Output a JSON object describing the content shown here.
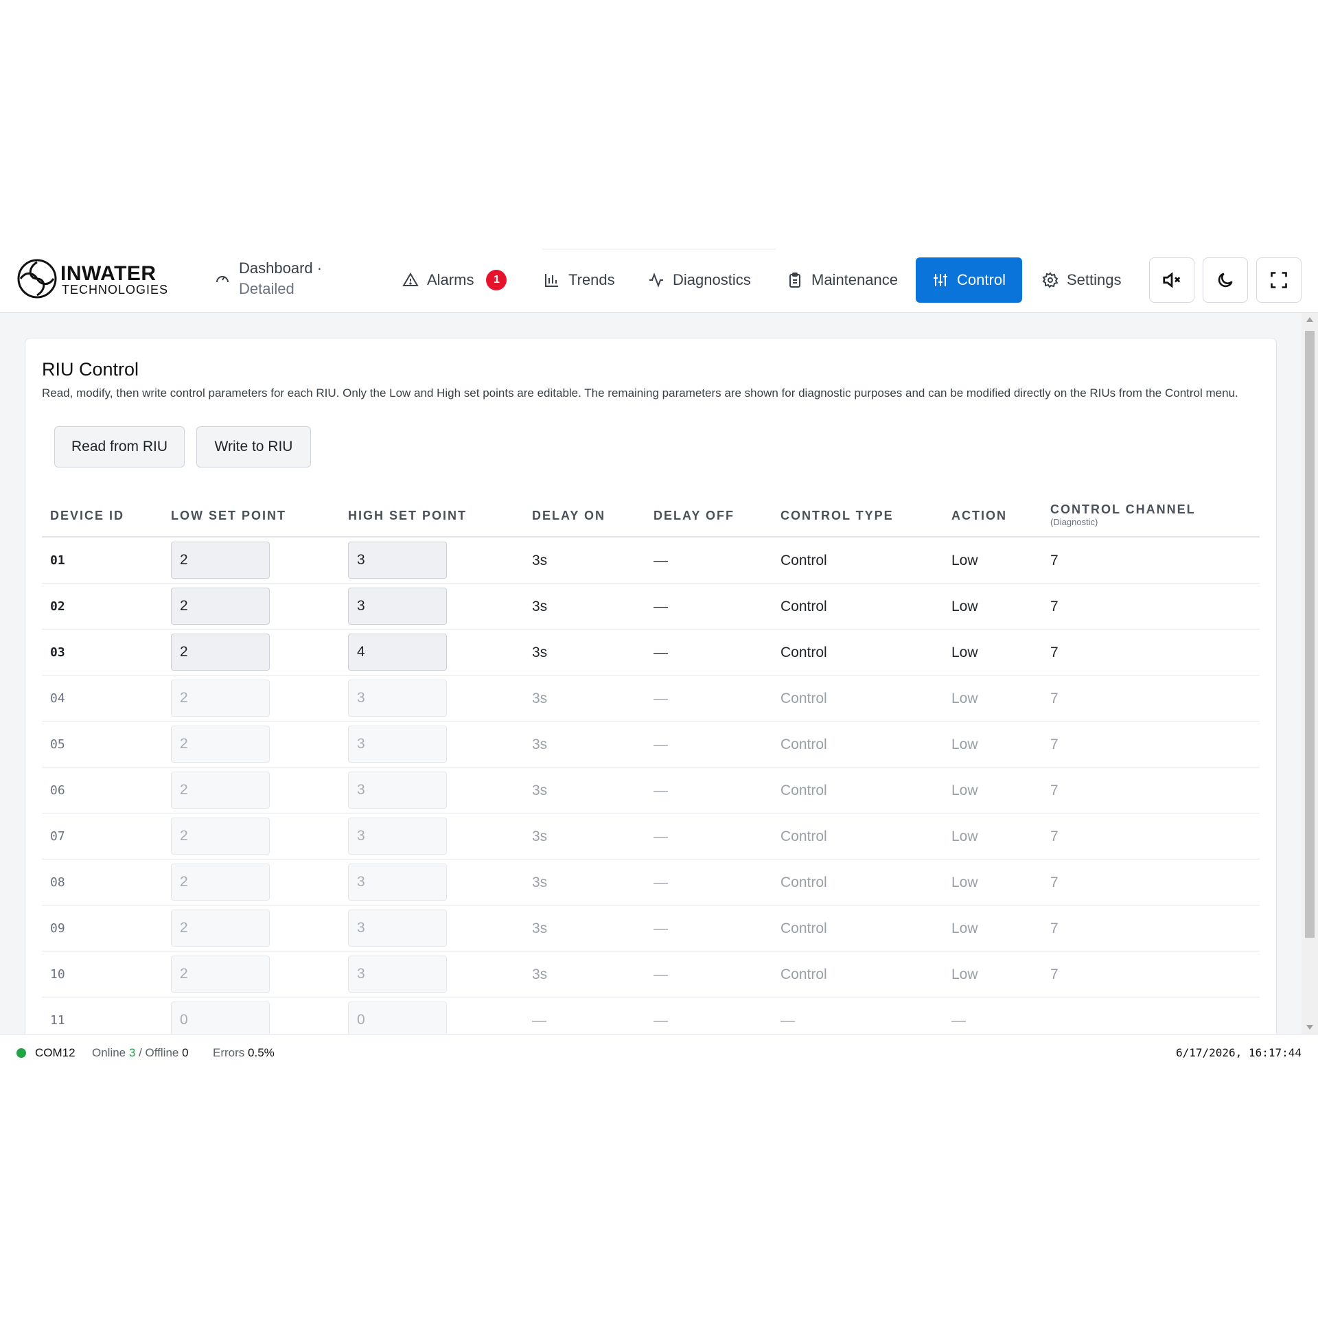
{
  "brand": {
    "name": "INWATER",
    "subtitle": "TECHNOLOGIES"
  },
  "nav": {
    "dashboard": {
      "label": "Dashboard ·",
      "sub": "Detailed"
    },
    "alarms": {
      "label": "Alarms",
      "badge": "1"
    },
    "trends": {
      "label": "Trends"
    },
    "diagnostics": {
      "label": "Diagnostics"
    },
    "maintenance": {
      "label": "Maintenance"
    },
    "control": {
      "label": "Control",
      "active": true
    },
    "settings": {
      "label": "Settings"
    }
  },
  "toolbar_icons": [
    "speaker-muted-icon",
    "moon-icon",
    "fullscreen-icon"
  ],
  "panel": {
    "title": "RIU Control",
    "description": "Read, modify, then write control parameters for each RIU. Only the Low and High set points are editable. The remaining parameters are shown for diagnostic purposes and can be modified directly on the RIUs from the Control menu.",
    "read_button": "Read from RIU",
    "write_button": "Write to RIU"
  },
  "table": {
    "headers": {
      "device_id": "DEVICE ID",
      "low": "LOW SET POINT",
      "high": "HIGH SET POINT",
      "delay_on": "DELAY ON",
      "delay_off": "DELAY OFF",
      "control_type": "CONTROL TYPE",
      "action": "ACTION",
      "channel": "CONTROL CHANNEL",
      "channel_sub": "(Diagnostic)"
    },
    "rows": [
      {
        "id": "01",
        "low": "2",
        "high": "3",
        "delay_on": "3s",
        "delay_off": "—",
        "type": "Control",
        "action": "Low",
        "channel": "7",
        "active": true
      },
      {
        "id": "02",
        "low": "2",
        "high": "3",
        "delay_on": "3s",
        "delay_off": "—",
        "type": "Control",
        "action": "Low",
        "channel": "7",
        "active": true
      },
      {
        "id": "03",
        "low": "2",
        "high": "4",
        "delay_on": "3s",
        "delay_off": "—",
        "type": "Control",
        "action": "Low",
        "channel": "7",
        "active": true
      },
      {
        "id": "04",
        "low": "2",
        "high": "3",
        "delay_on": "3s",
        "delay_off": "—",
        "type": "Control",
        "action": "Low",
        "channel": "7",
        "active": false
      },
      {
        "id": "05",
        "low": "2",
        "high": "3",
        "delay_on": "3s",
        "delay_off": "—",
        "type": "Control",
        "action": "Low",
        "channel": "7",
        "active": false
      },
      {
        "id": "06",
        "low": "2",
        "high": "3",
        "delay_on": "3s",
        "delay_off": "—",
        "type": "Control",
        "action": "Low",
        "channel": "7",
        "active": false
      },
      {
        "id": "07",
        "low": "2",
        "high": "3",
        "delay_on": "3s",
        "delay_off": "—",
        "type": "Control",
        "action": "Low",
        "channel": "7",
        "active": false
      },
      {
        "id": "08",
        "low": "2",
        "high": "3",
        "delay_on": "3s",
        "delay_off": "—",
        "type": "Control",
        "action": "Low",
        "channel": "7",
        "active": false
      },
      {
        "id": "09",
        "low": "2",
        "high": "3",
        "delay_on": "3s",
        "delay_off": "—",
        "type": "Control",
        "action": "Low",
        "channel": "7",
        "active": false
      },
      {
        "id": "10",
        "low": "2",
        "high": "3",
        "delay_on": "3s",
        "delay_off": "—",
        "type": "Control",
        "action": "Low",
        "channel": "7",
        "active": false
      },
      {
        "id": "11",
        "low": "0",
        "high": "0",
        "delay_on": "—",
        "delay_off": "—",
        "type": "—",
        "action": "—",
        "channel": "",
        "active": false
      }
    ]
  },
  "status": {
    "port": "COM12",
    "online_label": "Online",
    "online": "3",
    "offline_label": "/ Offline",
    "offline": "0",
    "errors_label": "Errors",
    "errors": "0.5%",
    "timestamp": "6/17/2026, 16:17:44"
  },
  "colors": {
    "accent": "#0a74da",
    "alarm_badge": "#e5132b",
    "online_green": "#22a447"
  }
}
